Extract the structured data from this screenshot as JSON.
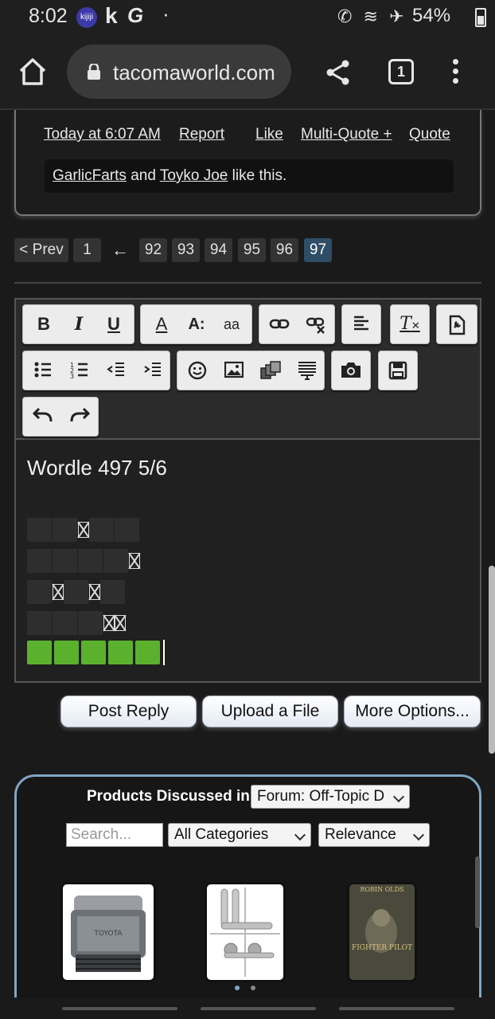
{
  "status_bar": {
    "time": "8:02",
    "kijiji_label": "kijiji",
    "k_label": "k",
    "g_label": "G",
    "dot": "·",
    "icons": "✆ ≋ ✈",
    "battery": "54%"
  },
  "browser": {
    "url": "tacomaworld.com",
    "tab_count": "1"
  },
  "post": {
    "timestamp": "Today at 6:07 AM",
    "report": "Report",
    "like": "Like",
    "multi_quote": "Multi-Quote +",
    "quote": "Quote",
    "likers": [
      "GarlicFarts",
      "Toyko Joe"
    ],
    "and": "and",
    "like_this": "like this."
  },
  "pagination": {
    "prev": "< Prev",
    "first": "1",
    "ellipsis": "←",
    "pages": [
      "92",
      "93",
      "94",
      "95",
      "96",
      "97"
    ],
    "current": "97"
  },
  "toolbar": {
    "bold": "B",
    "italic": "I",
    "underline": "U",
    "font_color": "A",
    "font_size": "A:",
    "font_family": "aa"
  },
  "editor": {
    "text": "Wordle 497 5/6",
    "grid": [
      [
        "black",
        "black",
        "glyph",
        "black",
        "black"
      ],
      [
        "black",
        "black",
        "black",
        "black",
        "glyph"
      ],
      [
        "black",
        "glyph",
        "black",
        "glyph",
        "black"
      ],
      [
        "black",
        "black",
        "black",
        "glyph",
        "glyph"
      ],
      [
        "green",
        "green",
        "green",
        "green",
        "green"
      ]
    ]
  },
  "actions": {
    "post_reply": "Post Reply",
    "upload_file": "Upload a File",
    "more_options": "More Options..."
  },
  "products": {
    "title": "Products Discussed in",
    "forum_select": "Forum: Off-Topic D",
    "search_placeholder": "Search...",
    "category_select": "All Categories",
    "sort_select": "Relevance",
    "book_title": "FIGHTER PILOT",
    "book_author": "ROBIN OLDS",
    "filter_brand": "TOYOTA"
  },
  "colors": {
    "accent_page": "#2e4d66",
    "wordle_green": "#5bb12e",
    "products_border": "#7fa6c4"
  }
}
